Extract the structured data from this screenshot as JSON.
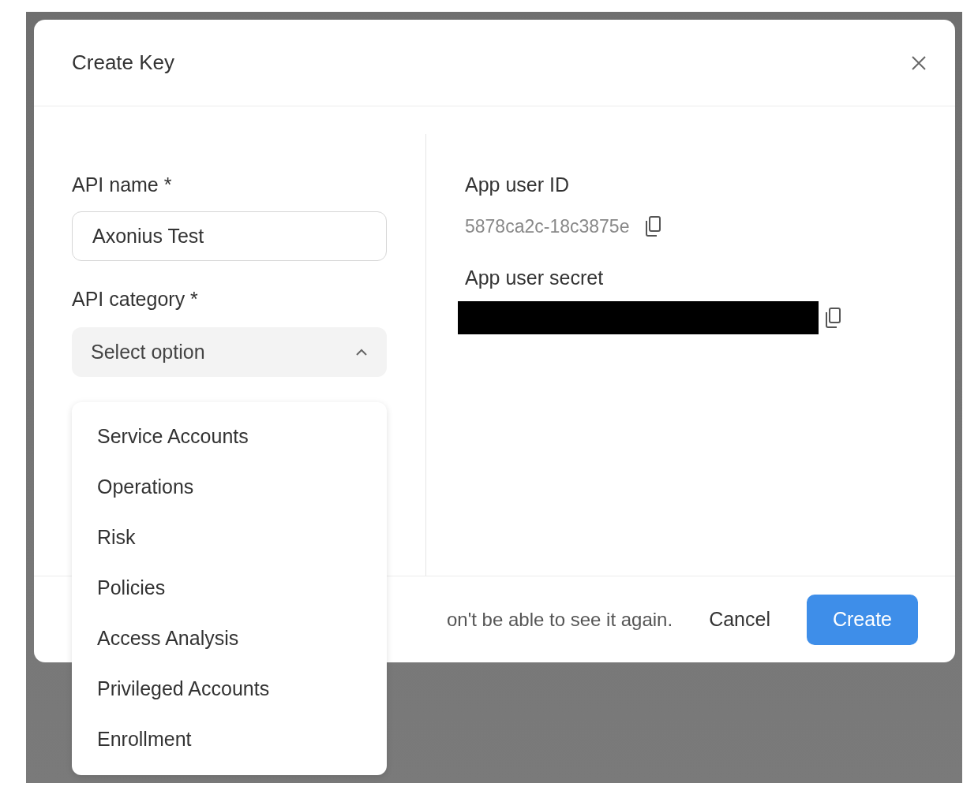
{
  "dialog": {
    "title": "Create Key"
  },
  "api_name": {
    "label": "API name *",
    "value": "Axonius Test"
  },
  "api_category": {
    "label": "API category *",
    "placeholder": "Select option",
    "expanded": true,
    "options": [
      {
        "label": "Service Accounts"
      },
      {
        "label": "Operations"
      },
      {
        "label": "Risk"
      },
      {
        "label": "Policies"
      },
      {
        "label": "Access Analysis"
      },
      {
        "label": "Privileged Accounts"
      },
      {
        "label": "Enrollment"
      }
    ]
  },
  "app_user_id": {
    "label": "App user ID",
    "value": "5878ca2c-18c3875e"
  },
  "app_user_secret": {
    "label": "App user secret",
    "redacted": true
  },
  "footer": {
    "note": "on't be able to see it again.",
    "buttons": [
      {
        "label": "Cancel",
        "kind": "secondary"
      },
      {
        "label": "Create",
        "kind": "primary"
      }
    ]
  }
}
